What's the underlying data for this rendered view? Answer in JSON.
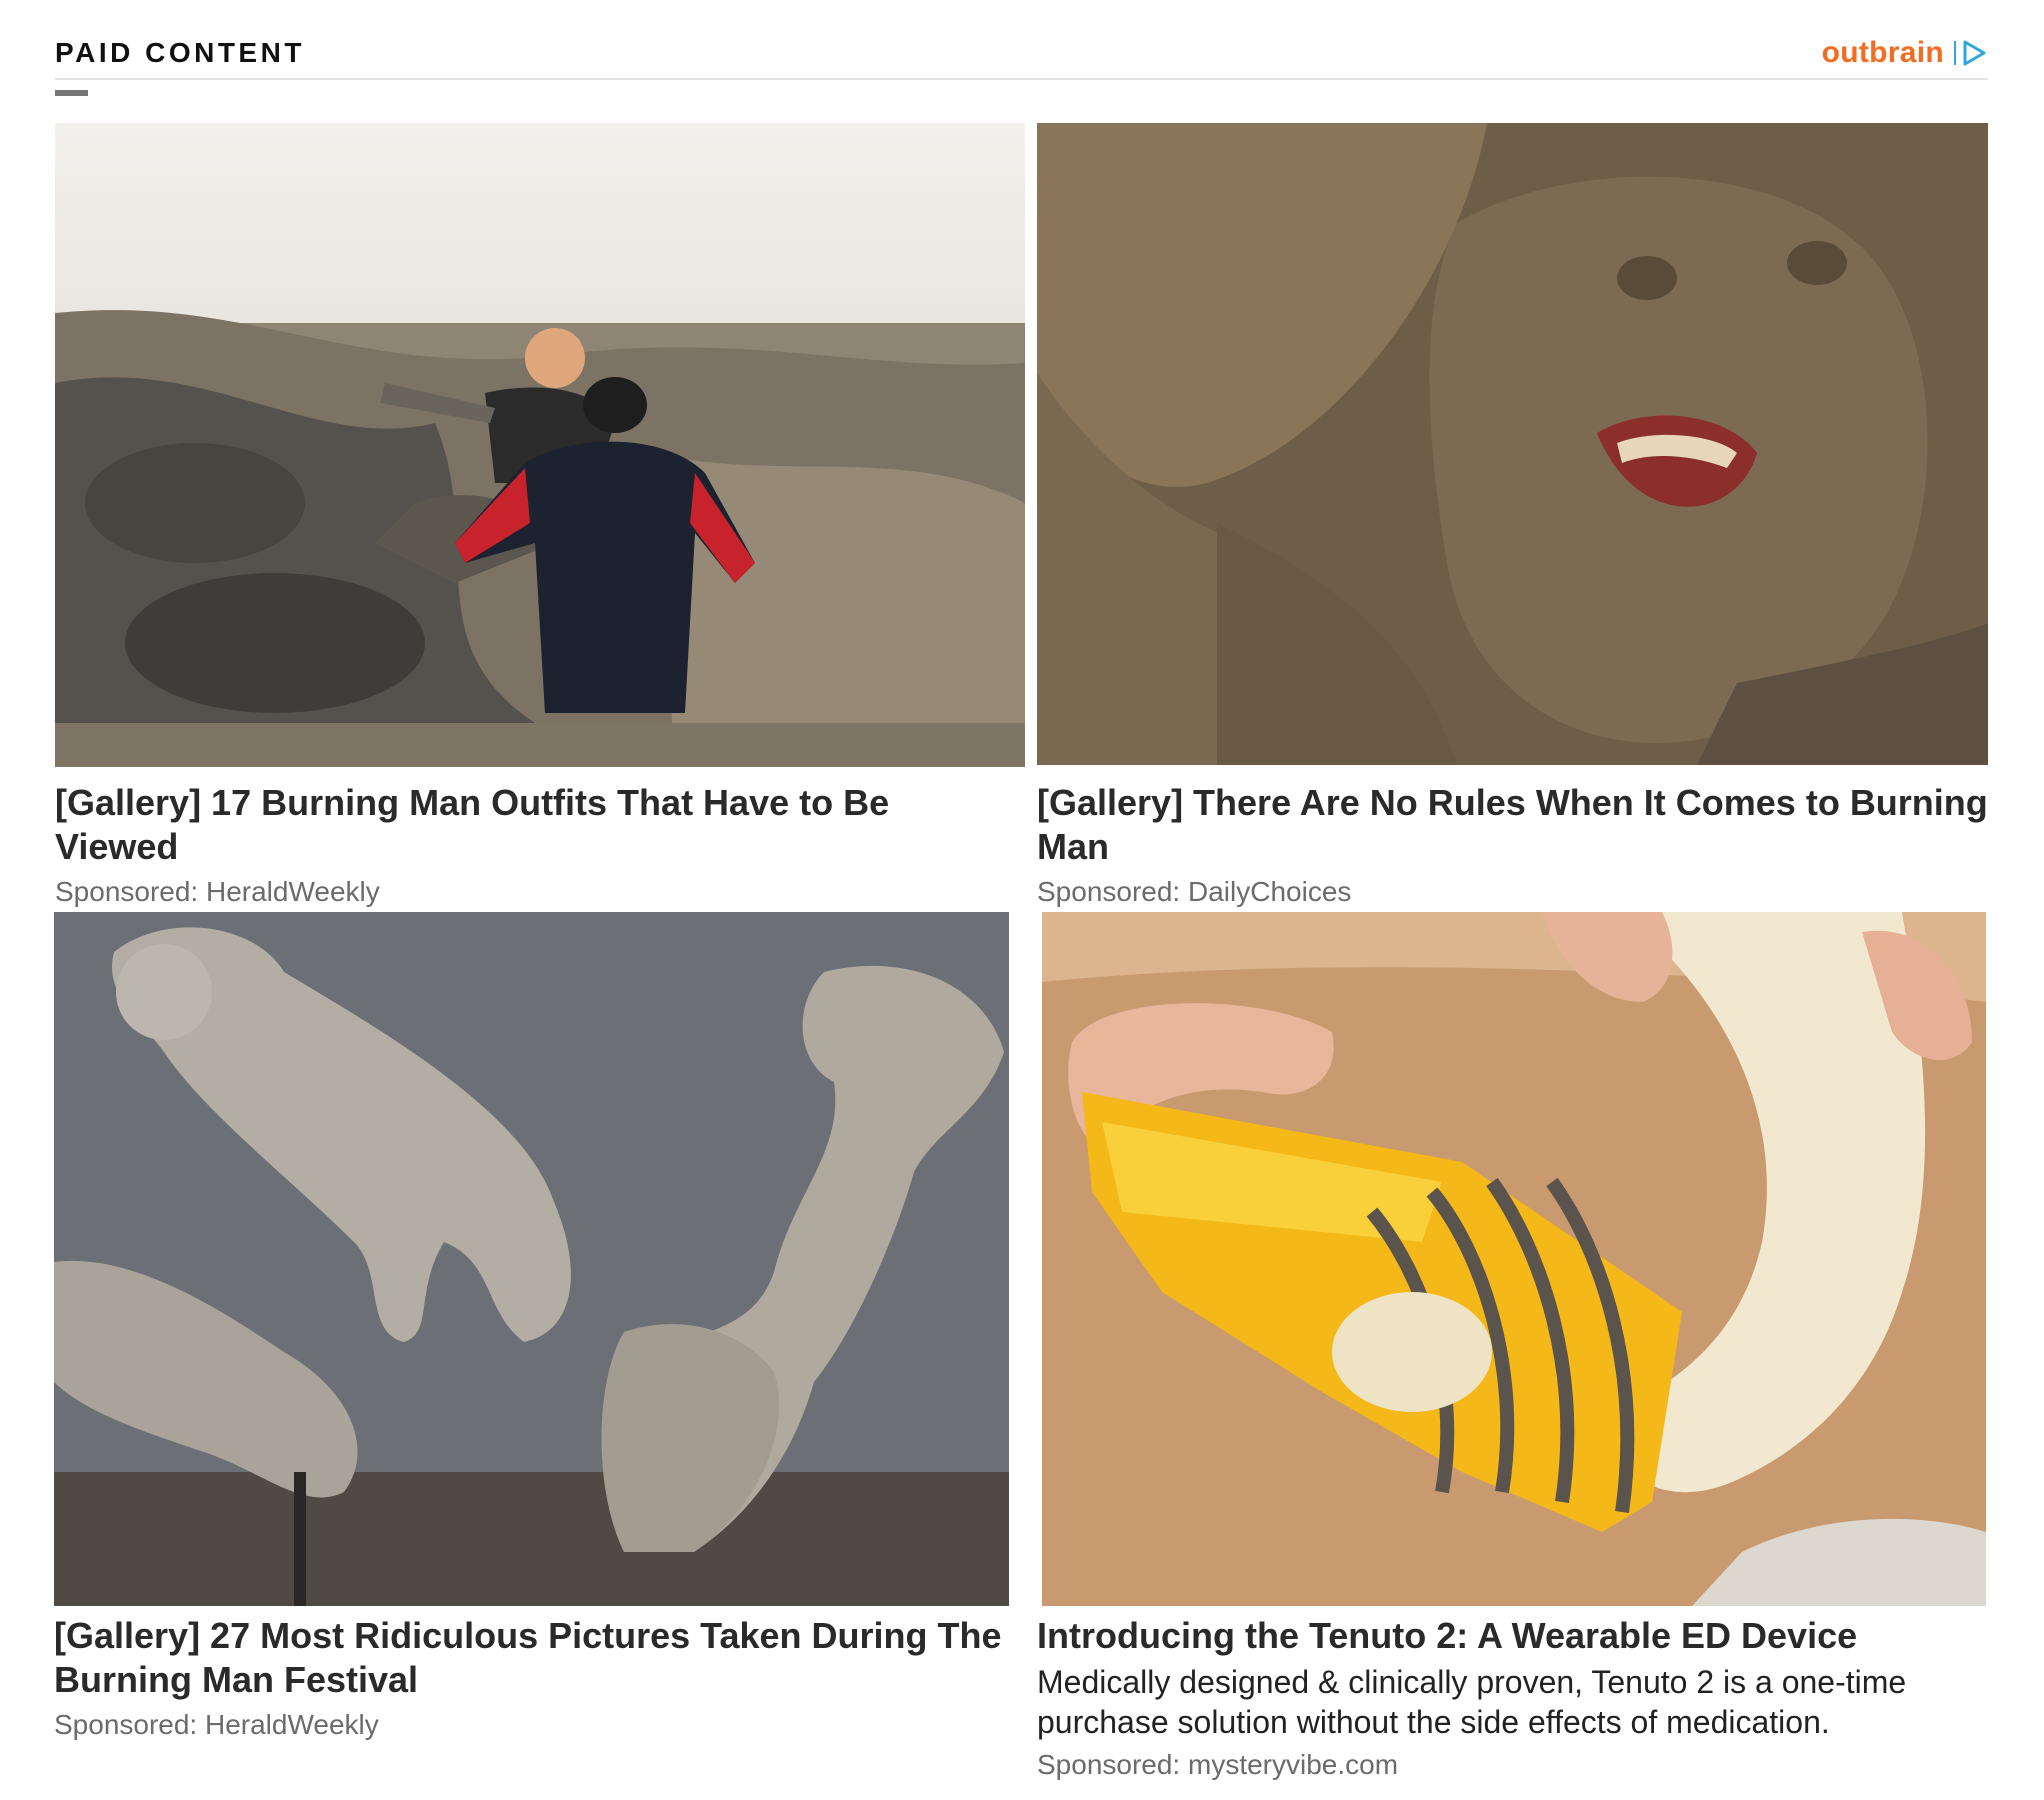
{
  "header": {
    "label": "PAID CONTENT",
    "brand": "Outbrain",
    "accent_color": "#f36c21",
    "adchoices_color": "#2ea7d9"
  },
  "cards": [
    {
      "title": "[Gallery] 17 Burning Man Outfits That Have to Be Viewed",
      "source": "Sponsored: HeraldWeekly",
      "image": "people-stuck-in-mud-photo"
    },
    {
      "title": "[Gallery] There Are No Rules When It Comes to Burning Man",
      "source": "Sponsored: DailyChoices",
      "image": "mud-covered-laughing-man-photo"
    },
    {
      "title": "[Gallery] 27 Most Ridiculous Pictures Taken During The Burning Man Festival",
      "source": "Sponsored: HeraldWeekly",
      "image": "plaster-casts-of-figures-photo"
    },
    {
      "title": "Introducing the Tenuto 2: A Wearable ED Device",
      "description": "Medically designed & clinically proven, Tenuto 2 is a one-time purchase solution without the side effects of medication.",
      "source": "Sponsored: mysteryvibe.com",
      "image": "banana-slicer-tool-photo"
    }
  ]
}
